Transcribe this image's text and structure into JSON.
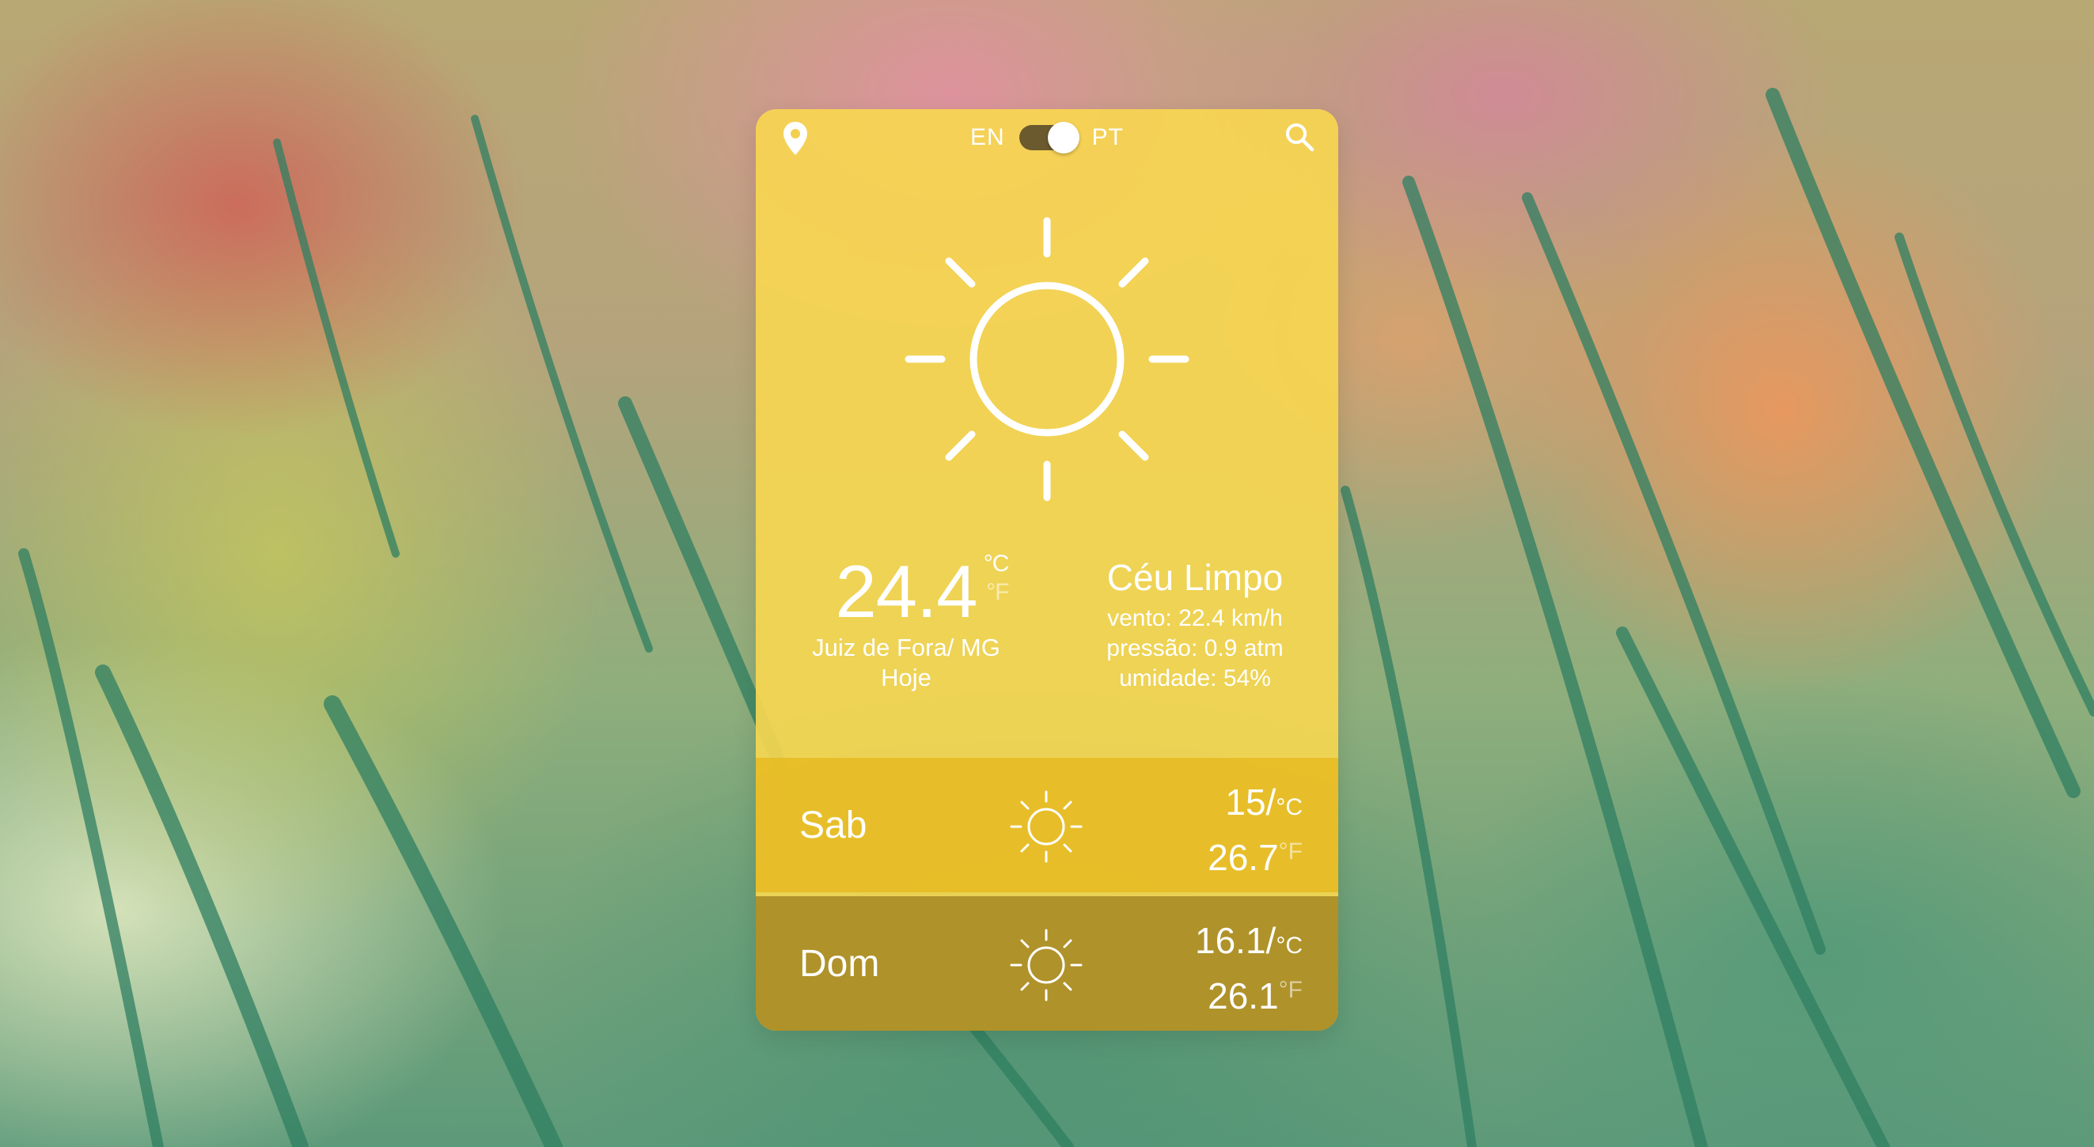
{
  "header": {
    "lang_en": "EN",
    "lang_pt": "PT",
    "selected_language": "PT"
  },
  "current": {
    "temperature": "24.4",
    "unit_c": "°C",
    "unit_f": "°F",
    "location": "Juiz de Fora/ MG",
    "day_label": "Hoje",
    "condition": "Céu Limpo",
    "wind": "vento: 22.4 km/h",
    "pressure": "pressão: 0.9 atm",
    "humidity": "umidade: 54%",
    "icon": "sun-icon"
  },
  "forecast": [
    {
      "day": "Sab",
      "temp_c": "15/",
      "unit_c": "°C",
      "temp_f": "26.7",
      "unit_f": "°F",
      "icon": "sun-icon"
    },
    {
      "day": "Dom",
      "temp_c": "16.1/",
      "unit_c": "°C",
      "temp_f": "26.1",
      "unit_f": "°F",
      "icon": "sun-icon"
    }
  ],
  "colors": {
    "card": "#f8d750",
    "row_saturday": "#e6b91e",
    "row_sunday": "#a58723",
    "text": "#ffffff"
  }
}
